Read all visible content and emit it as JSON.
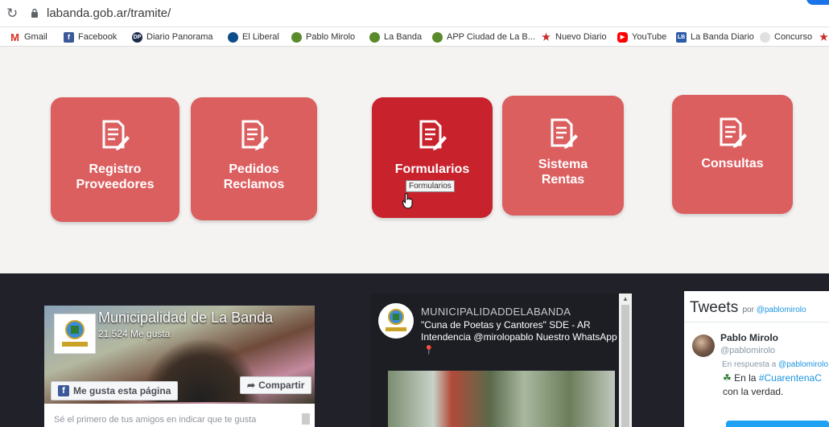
{
  "browser": {
    "url": "labanda.gob.ar/tramite/",
    "bookmarks": [
      {
        "label": "Gmail",
        "icon": "gmail-icon",
        "color": "#d93025"
      },
      {
        "label": "Facebook",
        "icon": "facebook-icon",
        "color": "#3b5998"
      },
      {
        "label": "Diario Panorama",
        "icon": "panorama-icon",
        "color": "#1c2b4a"
      },
      {
        "label": "El Liberal",
        "icon": "el-liberal-icon",
        "color": "#0d4d8a"
      },
      {
        "label": "Pablo Mirolo",
        "icon": "municipal-seal-icon",
        "color": "#5a8a2a"
      },
      {
        "label": "La Banda",
        "icon": "municipal-seal-icon",
        "color": "#5a8a2a"
      },
      {
        "label": "APP Ciudad de La B...",
        "icon": "municipal-seal-icon",
        "color": "#5a8a2a"
      },
      {
        "label": "Nuevo Diario",
        "icon": "nuevo-diario-icon",
        "color": "#c62828"
      },
      {
        "label": "YouTube",
        "icon": "youtube-icon",
        "color": "#ff0000"
      },
      {
        "label": "La Banda Diario",
        "icon": "la-banda-diario-icon",
        "color": "#2b5aa6"
      },
      {
        "label": "Concurso",
        "icon": "globe-icon",
        "color": "#9e9e9e"
      }
    ]
  },
  "tiles": [
    {
      "line1": "Registro",
      "line2": "Proveedores"
    },
    {
      "line1": "Pedidos",
      "line2": "Reclamos"
    },
    {
      "line1": "Formularios",
      "line2": ""
    },
    {
      "line1": "Sistema",
      "line2": "Rentas"
    },
    {
      "line1": "Consultas",
      "line2": ""
    }
  ],
  "tooltip": "Formularios",
  "facebook": {
    "page_name": "Municipalidad de La Banda",
    "likes": "21.524 Me gusta",
    "like_button": "Me gusta esta página",
    "share_button": "Compartir",
    "friends_text": "Sé el primero de tus amigos en indicar que te gusta"
  },
  "instagram": {
    "username": "MUNICIPALIDADDELABANDA",
    "bio_line1": "\"Cuna de Poetas y Cantores\" SDE - AR",
    "bio_line2": "Intendencia @mirolopablo Nuestro WhatsApp",
    "pin": "📍"
  },
  "twitter": {
    "title": "Tweets",
    "by_prefix": "por",
    "by_handle": "@pablomirolo",
    "author_name": "Pablo Mirolo",
    "author_handle": "@pablomirolo",
    "reply_prefix": "En respuesta a",
    "reply_handle": "@pablomirolo",
    "text_prefix": "En la",
    "hashtag": "#CuarentenaC",
    "text_line2": "con la verdad."
  },
  "colors": {
    "tile": "#dc5f60",
    "tile_active": "#c8222c",
    "dark_band": "#212229"
  }
}
